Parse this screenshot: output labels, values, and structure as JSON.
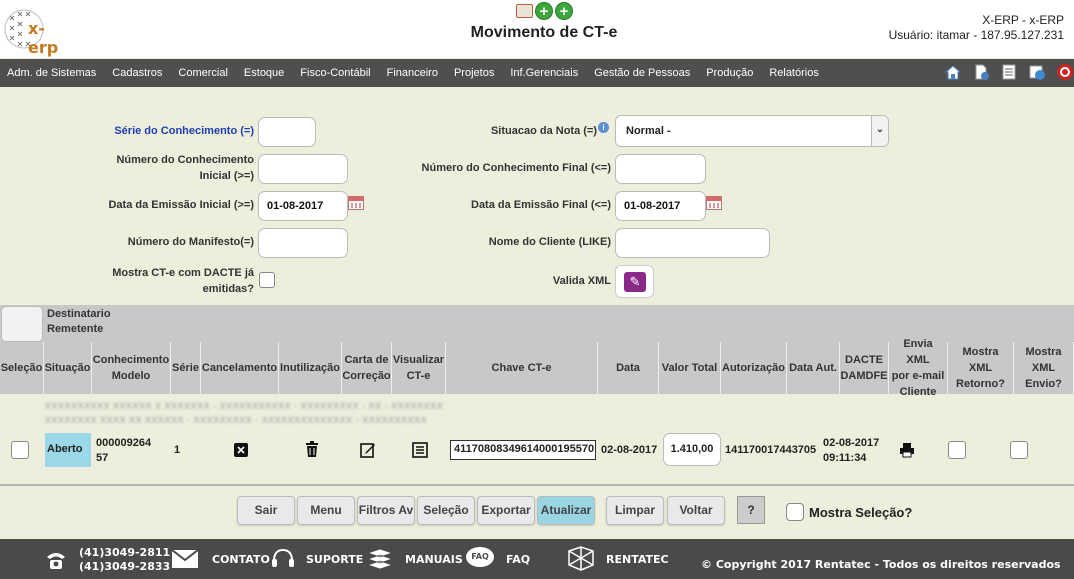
{
  "header": {
    "logo_text": "x-erp",
    "title": "Movimento de CT-e",
    "user_line1": "X-ERP - x-ERP",
    "user_line2": "Usuário: itamar - 187.95.127.231",
    "add_icon_symbol": "+"
  },
  "menu": {
    "items": [
      "Adm. de Sistemas",
      "Cadastros",
      "Comercial",
      "Estoque",
      "Fisco-Contábil",
      "Financeiro",
      "Projetos",
      "Inf.Gerenciais",
      "Gestão de Pessoas",
      "Produção",
      "Relatórios"
    ],
    "right_icons": [
      "home-icon",
      "document-add-icon",
      "document-list-icon",
      "refresh-settings-icon",
      "power-icon"
    ]
  },
  "form": {
    "serie_label": "Série do Conhecimento (=)",
    "serie_value": "",
    "situacao_label": "Situacao da Nota (=)",
    "situacao_value": "Normal -",
    "numero_inicial_label_1": "Número do Conhecimento",
    "numero_inicial_label_2": "Inicial (>=)",
    "numero_inicial_value": "",
    "numero_final_label": "Número do Conhecimento Final (<=)",
    "numero_final_value": "",
    "data_inicial_label": "Data da Emissão Inicial (>=)",
    "data_inicial_value": "01-08-2017",
    "data_final_label": "Data da Emissão Final (<=)",
    "data_final_value": "01-08-2017",
    "manifesto_label": "Número do Manifesto(=)",
    "manifesto_value": "",
    "cliente_label": "Nome do Cliente (LIKE)",
    "cliente_value": "",
    "mostra_dacte_label_1": "Mostra CT-e com DACTE já",
    "mostra_dacte_label_2": "emitidas?",
    "valida_xml_label": "Valida XML"
  },
  "table": {
    "group_label_1": "Destinatario",
    "group_label_2": "Remetente",
    "headers": [
      {
        "l1": "Seleção",
        "l2": ""
      },
      {
        "l1": "Situação",
        "l2": ""
      },
      {
        "l1": "Conhecimento",
        "l2": "Modelo"
      },
      {
        "l1": "Série",
        "l2": ""
      },
      {
        "l1": "Cancelamento",
        "l2": ""
      },
      {
        "l1": "Inutilização",
        "l2": ""
      },
      {
        "l1": "Carta de",
        "l2": "Correção"
      },
      {
        "l1": "Visualizar",
        "l2": "CT-e"
      },
      {
        "l1": "Chave CT-e",
        "l2": ""
      },
      {
        "l1": "Data",
        "l2": ""
      },
      {
        "l1": "Valor Total",
        "l2": ""
      },
      {
        "l1": "Autorização",
        "l2": ""
      },
      {
        "l1": "Data Aut.",
        "l2": ""
      },
      {
        "l1": "DACTE",
        "l2": "DAMDFE"
      },
      {
        "l1": "Envia XML",
        "l2": "por e-mail",
        "l3": "Cliente"
      },
      {
        "l1": "Mostra XML",
        "l2": "Retorno?"
      },
      {
        "l1": "Mostra XML",
        "l2": "Envio?"
      }
    ],
    "row": {
      "blur_line1": "XXXXXXXXXX XXXXXX X XXXXXXX - XXXXXXXXXXX - XXXXXXXXX - XX - XXXXXXXX",
      "blur_line2": "XXXXXXXX XXXX XX XXXXXX - XXXXXXXXX - XXXXXXXXXXXXXX - XXXXXXXXXX",
      "situacao": "Aberto",
      "conhecimento_1": "000009264",
      "conhecimento_2": "57",
      "serie": "1",
      "chave": "41170808349614000195570",
      "data": "02-08-2017",
      "valor_total": "1.410,00",
      "autorizacao": "141170017443705",
      "data_aut_1": "02-08-2017",
      "data_aut_2": "09:11:34"
    }
  },
  "buttons": {
    "sair": "Sair",
    "menu": "Menu",
    "filtros": "Filtros Av",
    "selecao": "Seleção",
    "exportar": "Exportar",
    "atualizar": "Atualizar",
    "limpar": "Limpar",
    "voltar": "Voltar",
    "help": "?",
    "mostra_selecao": "Mostra Seleção?"
  },
  "footer": {
    "phone1": "(41)3049-2811",
    "phone2": "(41)3049-2833",
    "contato": "CONTATO",
    "suporte": "SUPORTE",
    "manuais": "MANUAIS",
    "faq_badge": "FAQ",
    "faq": "FAQ",
    "rentatec": "RENTATEC",
    "copyright": "© Copyright 2017 Rentatec - Todos os direitos reservados"
  }
}
